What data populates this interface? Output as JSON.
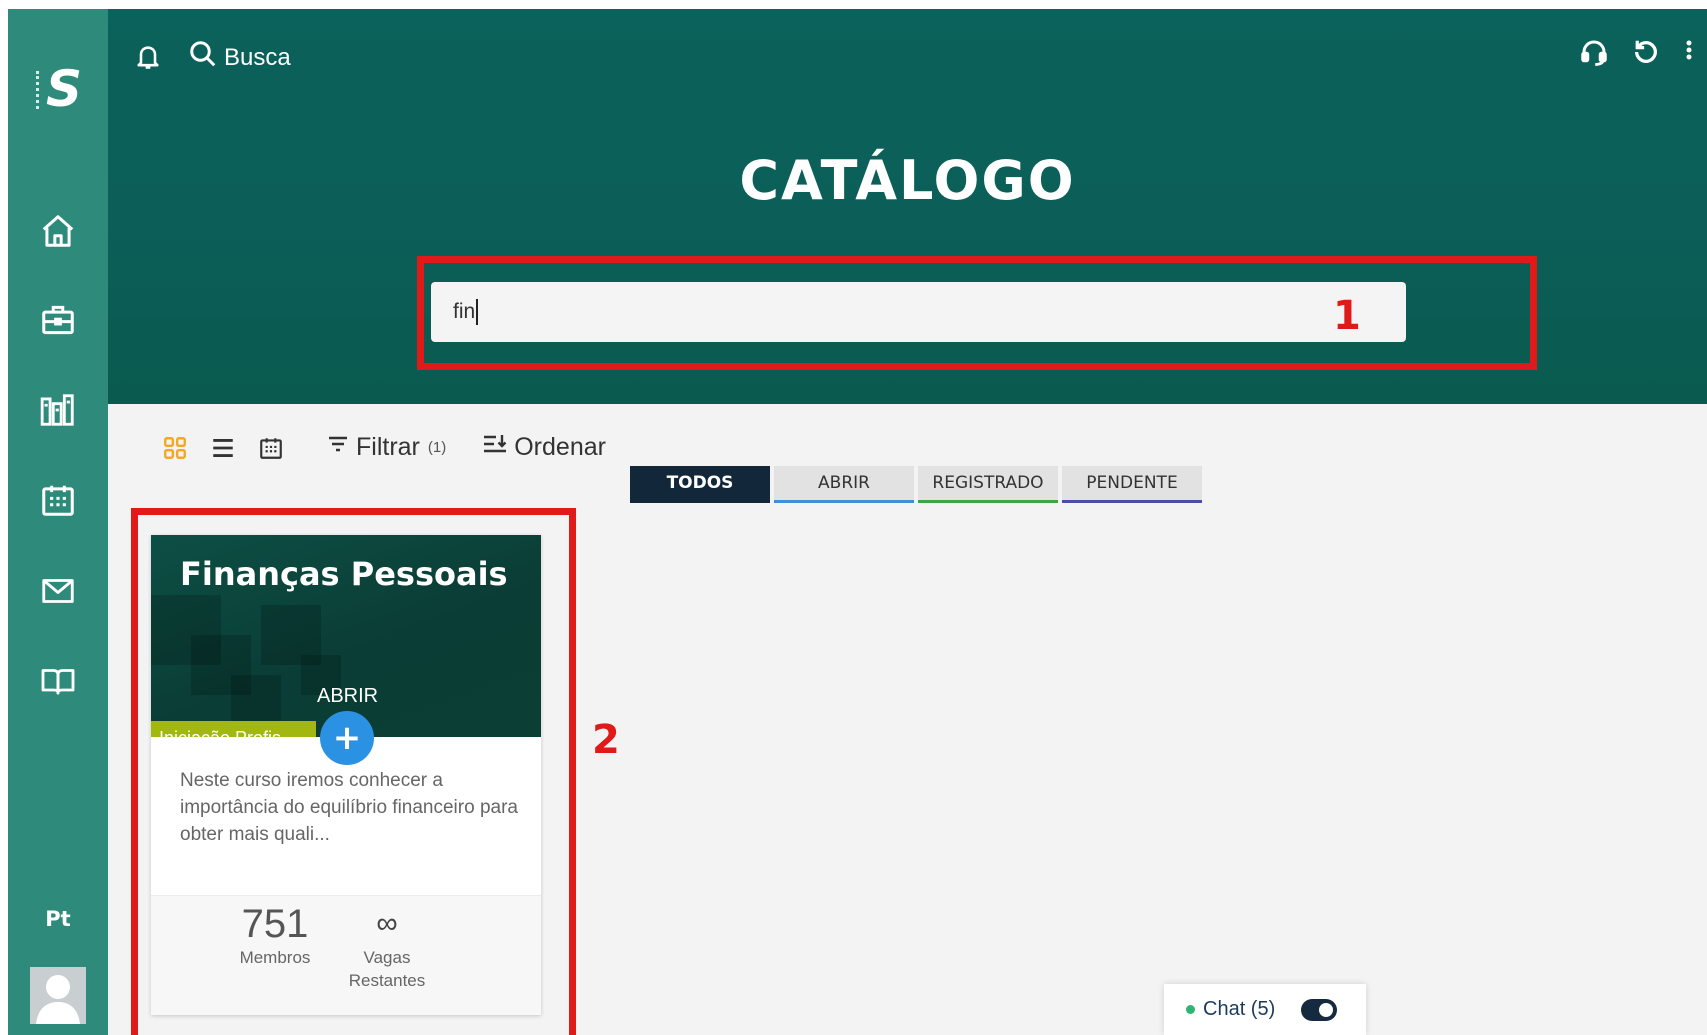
{
  "sidebar": {
    "logo_letter": "S",
    "language": "Pt",
    "nav_icons": [
      "home-icon",
      "briefcase-icon",
      "library-icon",
      "calendar-icon",
      "mail-icon",
      "book-open-icon"
    ]
  },
  "header": {
    "search_label": "Busca",
    "title": "CATÁLOGO",
    "search_value": "fin",
    "right_icons": [
      "headset-icon",
      "refresh-icon",
      "more-vertical-icon"
    ]
  },
  "annotations": {
    "search_marker": "1",
    "card_marker": "2"
  },
  "toolbar": {
    "view_icons": [
      "grid-view-icon",
      "list-view-icon",
      "calendar-view-icon"
    ],
    "filter_label": "Filtrar",
    "filter_count": "(1)",
    "sort_label": "Ordenar"
  },
  "tabs": [
    {
      "label": "TODOS",
      "color": "#13273a"
    },
    {
      "label": "ABRIR",
      "color": "#3f8fd8"
    },
    {
      "label": "REGISTRADO",
      "color": "#3aa645"
    },
    {
      "label": "PENDENTE",
      "color": "#4b4fa8"
    }
  ],
  "course_card": {
    "title": "Finanças Pessoais",
    "status": "ABRIR",
    "category": "Iniciação Profis...",
    "description": "Neste curso  iremos conhecer a importância do equilíbrio financeiro para obter mais quali...",
    "members_count": "751",
    "members_label": "Membros",
    "vacancies_value": "∞",
    "vacancies_label": "Vagas Restantes"
  },
  "chat": {
    "label": "Chat (5)"
  },
  "colors": {
    "sidebar": "#2e8a7a",
    "header": "#0b615b",
    "highlight": "#e01919",
    "category_badge": "#a3b711",
    "add_button": "#2b91e3"
  }
}
